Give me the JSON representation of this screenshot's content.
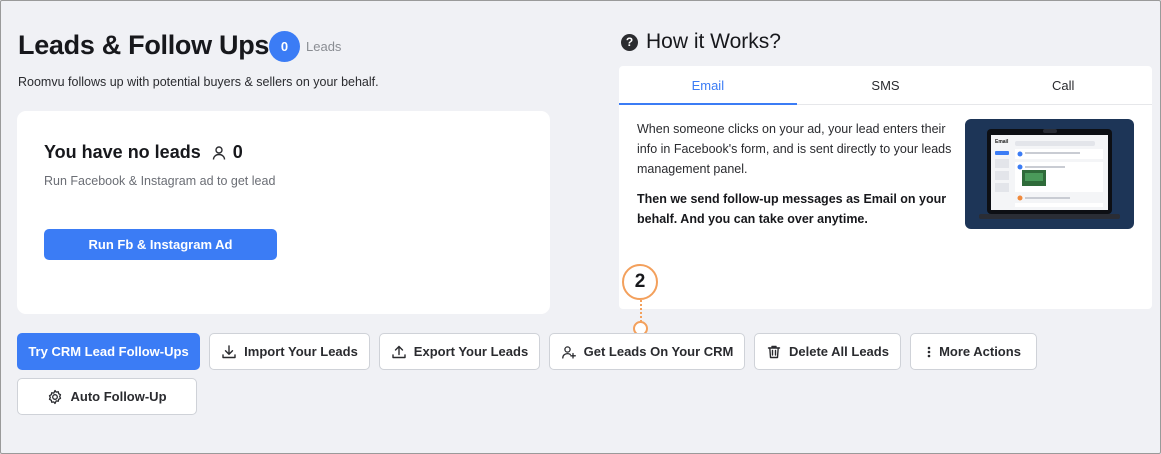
{
  "header": {
    "title": "Leads & Follow Ups",
    "leads_count": "0",
    "leads_unit": "Leads",
    "subtitle": "Roomvu follows up with potential buyers & sellers on your behalf."
  },
  "empty_state": {
    "title": "You have no leads",
    "count": "0",
    "description": "Run Facebook & Instagram ad to get lead",
    "button_label": "Run Fb & Instagram Ad"
  },
  "how_it_works": {
    "title": "How it Works?",
    "icon": "help-circle-icon",
    "tabs": [
      {
        "label": "Email",
        "active": true
      },
      {
        "label": "SMS",
        "active": false
      },
      {
        "label": "Call",
        "active": false
      }
    ],
    "paragraph1": "When someone clicks on your ad, your lead enters their info in Facebook's form, and is sent directly to your leads management panel.",
    "paragraph2": "Then we send follow-up messages as Email on your behalf. And you can take over anytime.",
    "preview_label": "Email"
  },
  "annotation": {
    "step_number": "2",
    "color": "#f3a05c"
  },
  "actions": {
    "try_crm": "Try CRM Lead Follow-Ups",
    "import": "Import Your Leads",
    "export": "Export Your Leads",
    "get_leads_crm": "Get Leads On Your CRM",
    "delete_all": "Delete All Leads",
    "more": "More Actions",
    "auto_follow_up": "Auto Follow-Up"
  },
  "colors": {
    "accent": "#3b7cf5",
    "background": "#f0f1f5"
  }
}
